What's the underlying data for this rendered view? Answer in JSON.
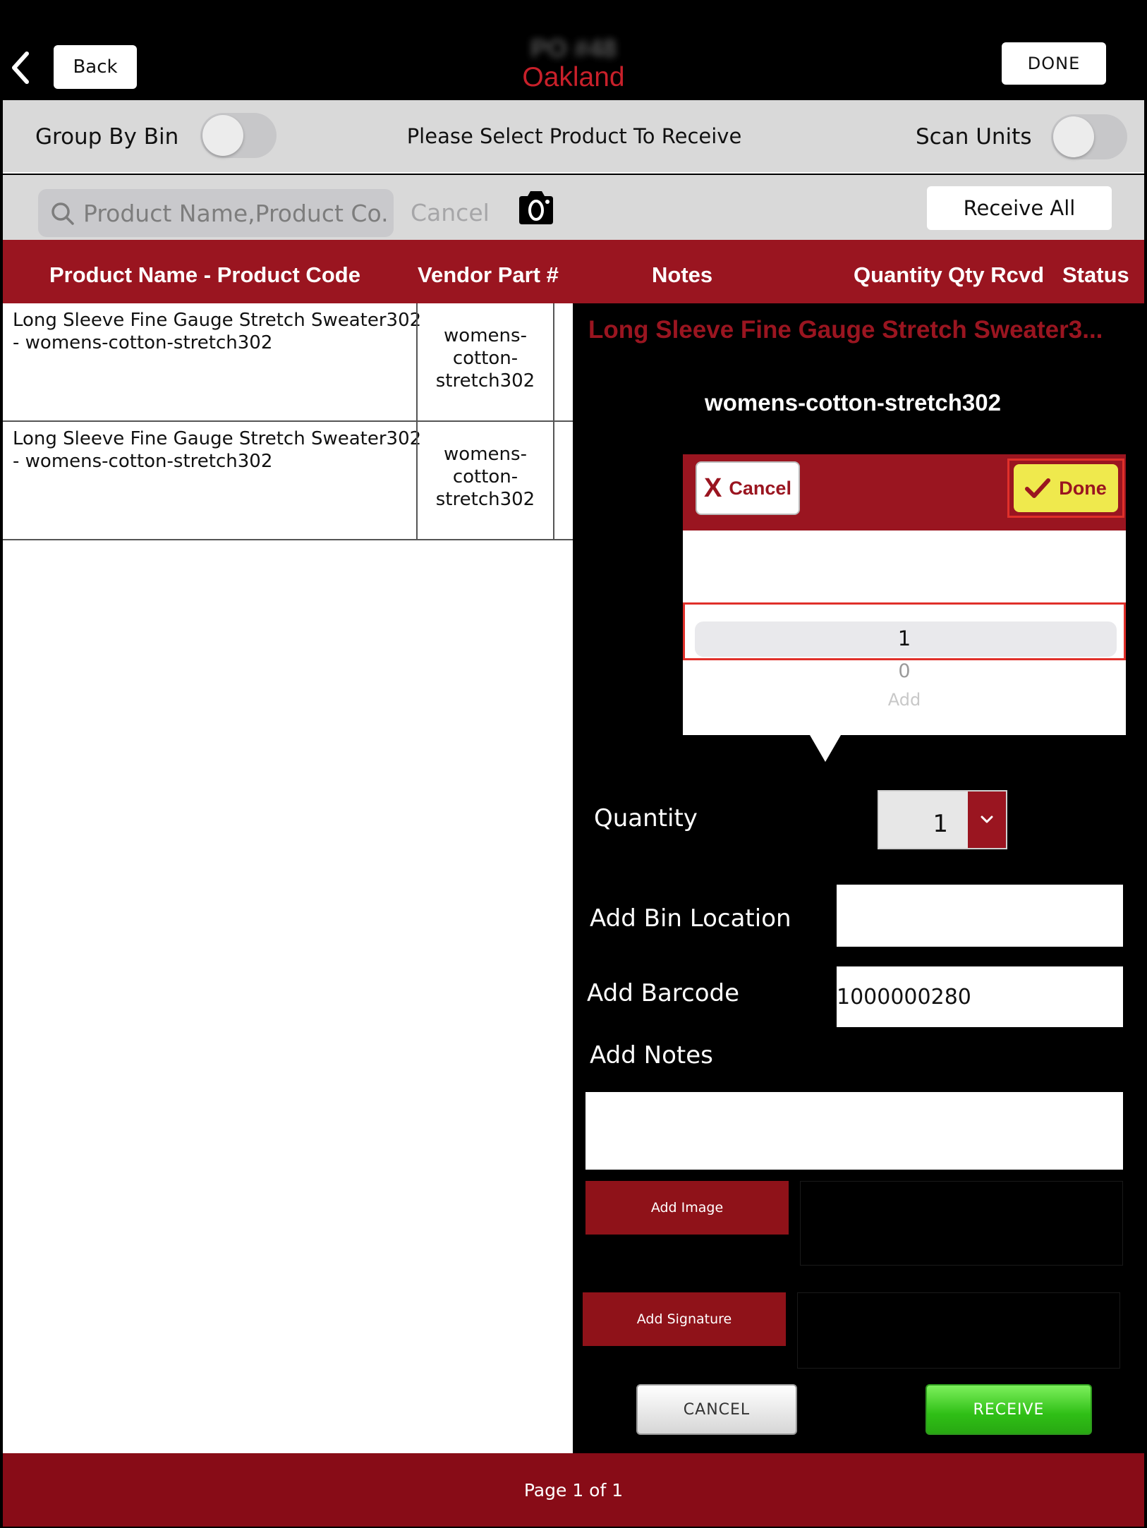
{
  "nav": {
    "back_label": "Back",
    "title": "PO #48",
    "subtitle": "Oakland",
    "done_label": "DONE"
  },
  "options": {
    "group_by_bin_label": "Group By Bin",
    "group_by_bin_on": false,
    "prompt": "Please Select Product To Receive",
    "scan_units_label": "Scan Units",
    "scan_units_on": false
  },
  "search": {
    "placeholder": "Product Name,Product Co...",
    "cancel_label": "Cancel",
    "receive_all_label": "Receive All"
  },
  "table": {
    "headers": {
      "product": "Product Name - Product Code",
      "vendor_part": "Vendor Part #",
      "notes": "Notes",
      "quantity": "Quantity",
      "qty_rcvd": "Qty Rcvd",
      "status": "Status"
    },
    "rows": [
      {
        "name": "Long Sleeve Fine Gauge Stretch Sweater302 - womens-cotton-stretch302",
        "vendor_part": "womens-cotton-stretch302"
      },
      {
        "name": "Long Sleeve Fine Gauge Stretch Sweater302 - womens-cotton-stretch302",
        "vendor_part": "womens-cotton-stretch302"
      }
    ]
  },
  "panel": {
    "product_title": "Long Sleeve Fine Gauge Stretch Sweater3...",
    "product_code": "womens-cotton-stretch302",
    "picker": {
      "cancel_label": "Cancel",
      "done_label": "Done",
      "selected": "1",
      "options_below": [
        "0",
        "Add"
      ]
    },
    "quantity_label": "Quantity",
    "quantity_value": "1",
    "bin_location_label": "Add Bin Location",
    "bin_location_value": "",
    "barcode_label": "Add Barcode",
    "barcode_value": "1000000280",
    "notes_label": "Add Notes",
    "notes_value": "",
    "add_image_label": "Add Image",
    "add_signature_label": "Add Signature",
    "cancel_label": "CANCEL",
    "receive_label": "RECEIVE"
  },
  "footer": {
    "page_label": "Page 1 of 1"
  },
  "colors": {
    "brand_red": "#9a1520",
    "footer_red": "#880c17",
    "highlight_yellow": "#efe94d",
    "receive_green": "#2fbf16"
  }
}
